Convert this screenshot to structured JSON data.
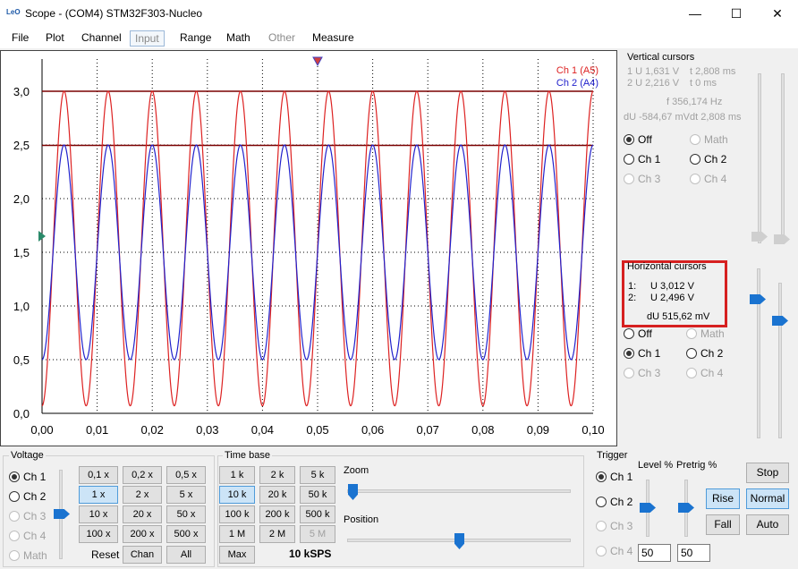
{
  "window": {
    "logo_text": "LeO",
    "title": "Scope - (COM4) STM32F303-Nucleo",
    "minimize_glyph": "—",
    "maximize_glyph": "☐",
    "close_glyph": "✕"
  },
  "menu": [
    {
      "label": "File"
    },
    {
      "label": "Plot"
    },
    {
      "label": "Channel"
    },
    {
      "label": "Input"
    },
    {
      "label": "Range"
    },
    {
      "label": "Math"
    },
    {
      "label": "Other"
    },
    {
      "label": "Measure"
    }
  ],
  "chart_data": {
    "type": "line",
    "x_ticks": [
      "0,00",
      "0,01",
      "0,02",
      "0,03",
      "0,04",
      "0,05",
      "0,06",
      "0,07",
      "0,08",
      "0,09",
      "0,10"
    ],
    "y_ticks": [
      "0,0",
      "0,5",
      "1,0",
      "1,5",
      "2,0",
      "2,5",
      "3,0"
    ],
    "xlim": [
      0,
      0.1
    ],
    "ylim": [
      0,
      3.3
    ],
    "grid": true,
    "legend_position": "top-right",
    "series": [
      {
        "name": "Ch 1 (A5)",
        "color": "#dd2222",
        "shape": "sine",
        "frequency": 125,
        "min": 0.07,
        "max": 3.0,
        "phase": 0.0
      },
      {
        "name": "Ch 2 (A4)",
        "color": "#2222cc",
        "shape": "sine",
        "frequency": 125,
        "min": 0.5,
        "max": 2.5,
        "phase": 0.0
      }
    ],
    "horizontal_cursors": [
      3.0,
      2.496
    ],
    "trigger_time": 0.05,
    "trigger_level": 1.65
  },
  "vertical_cursors": {
    "title": "Vertical cursors",
    "u1": "1 U 1,631 V",
    "t1": "t 2,808 ms",
    "u2": "2 U 2,216 V",
    "t2": "t 0 ms",
    "f": "f 356,174 Hz",
    "du": "dU -584,67 mV",
    "dt": "dt 2,808 ms",
    "options": [
      "Off",
      "Math",
      "Ch 1",
      "Ch 2",
      "Ch 3",
      "Ch 4"
    ]
  },
  "horizontal_cursors": {
    "title": "Horizontal cursors",
    "row1_idx": "1:",
    "row1_val": "U 3,012 V",
    "row2_idx": "2:",
    "row2_val": "U 2,496 V",
    "du": "dU 515,62 mV",
    "options": [
      "Off",
      "Math",
      "Ch 1",
      "Ch 2",
      "Ch 3",
      "Ch 4"
    ]
  },
  "voltage": {
    "title": "Voltage",
    "channels": [
      "Ch 1",
      "Ch 2",
      "Ch 3",
      "Ch 4",
      "Math"
    ],
    "scales": [
      "0,1 x",
      "0,2 x",
      "0,5 x",
      "1 x",
      "2 x",
      "5 x",
      "10 x",
      "20 x",
      "50 x",
      "100 x",
      "200 x",
      "500 x"
    ],
    "reset": "Reset",
    "chan": "Chan",
    "all": "All"
  },
  "timebase": {
    "title": "Time base",
    "rates": [
      "1 k",
      "2 k",
      "5 k",
      "10 k",
      "20 k",
      "50 k",
      "100 k",
      "200 k",
      "500 k",
      "1 M",
      "2 M",
      "5 M"
    ],
    "max": "Max",
    "sps": "10 kSPS",
    "zoom": "Zoom",
    "position": "Position"
  },
  "trigger": {
    "title": "Trigger",
    "level_label": "Level %",
    "pretrig_label": "Pretrig %",
    "channels": [
      "Ch 1",
      "Ch 2",
      "Ch 3",
      "Ch 4"
    ],
    "level_value": "50",
    "pretrig_value": "50",
    "stop": "Stop",
    "rise": "Rise",
    "normal": "Normal",
    "fall": "Fall",
    "auto": "Auto"
  }
}
